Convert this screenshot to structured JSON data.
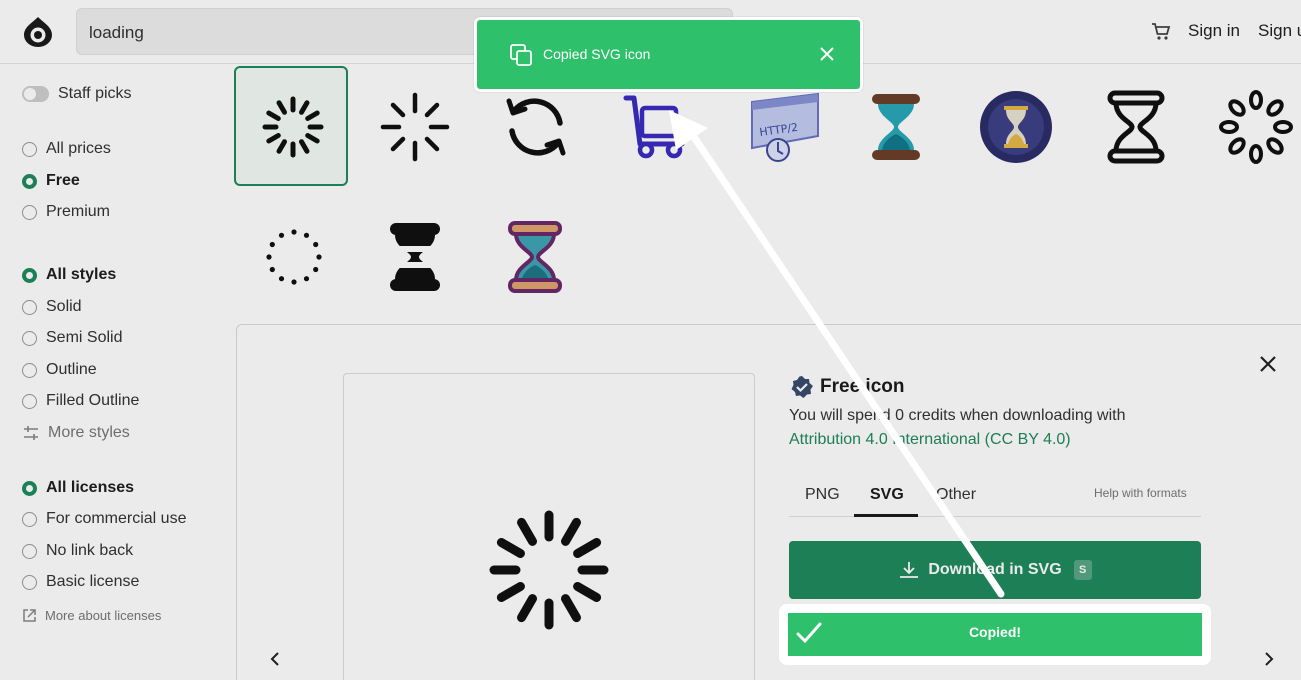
{
  "header": {
    "search_value": "loading",
    "sign_in": "Sign in",
    "sign_up": "Sign u"
  },
  "sidebar": {
    "staff_picks": "Staff picks",
    "prices": [
      {
        "label": "All prices",
        "selected": false
      },
      {
        "label": "Free",
        "selected": true
      },
      {
        "label": "Premium",
        "selected": false
      }
    ],
    "styles": [
      {
        "label": "All styles",
        "selected": true
      },
      {
        "label": "Solid",
        "selected": false
      },
      {
        "label": "Semi Solid",
        "selected": false
      },
      {
        "label": "Outline",
        "selected": false
      },
      {
        "label": "Filled Outline",
        "selected": false
      }
    ],
    "more_styles": "More styles",
    "licenses": [
      {
        "label": "All licenses",
        "selected": true
      },
      {
        "label": "For commercial use",
        "selected": false
      },
      {
        "label": "No link back",
        "selected": false
      },
      {
        "label": "Basic license",
        "selected": false
      }
    ],
    "more_about_licenses": "More about licenses"
  },
  "icons": [
    "spinner-icon",
    "loader-icon",
    "refresh-icon",
    "trolley-icon",
    "http2-icon",
    "hourglass-teal-icon",
    "hourglass-circle-icon",
    "hourglass-outline-icon",
    "spinner-rings-icon",
    "dots-spinner-icon",
    "hourglass-solid-icon",
    "hourglass-purple-icon"
  ],
  "detail": {
    "title": "Free icon",
    "credits": "You will spend 0 credits when downloading with",
    "license": "Attribution 4.0 International (CC BY 4.0)",
    "tabs": [
      "PNG",
      "SVG",
      "Other"
    ],
    "active_tab": "SVG",
    "help": "Help with formats",
    "download": "Download in SVG",
    "download_key": "S",
    "copied": "Copied!"
  },
  "toast": {
    "text": "Copied SVG icon"
  },
  "colors": {
    "accent": "#1f8a5e",
    "toast": "#2ec06a"
  }
}
